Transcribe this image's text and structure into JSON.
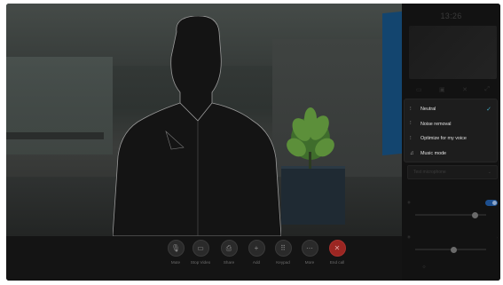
{
  "clock": "13:26",
  "controls": [
    {
      "id": "mute",
      "label": "Mute",
      "icon": "microphone-icon"
    },
    {
      "id": "stop-video",
      "label": "Stop Video",
      "icon": "camera-icon"
    },
    {
      "id": "share",
      "label": "Share",
      "icon": "share-icon"
    },
    {
      "id": "add",
      "label": "Add",
      "icon": "plus-icon"
    },
    {
      "id": "keypad",
      "label": "Keypad",
      "icon": "keypad-icon"
    },
    {
      "id": "more",
      "label": "More",
      "icon": "more-icon"
    },
    {
      "id": "end-call",
      "label": "End call",
      "icon": "close-icon"
    }
  ],
  "audio_menu": {
    "items": [
      {
        "label": "Neutral",
        "icon": "waveform-icon",
        "selected": true
      },
      {
        "label": "Noise removal",
        "icon": "noise-removal-icon",
        "selected": false
      },
      {
        "label": "Optimize for my voice",
        "icon": "voice-optimize-icon",
        "selected": false
      },
      {
        "label": "Music mode",
        "icon": "music-note-icon",
        "selected": false
      }
    ]
  },
  "test_microphone": "Test microphone",
  "colors": {
    "end_call": "#9b2622",
    "check": "#40a9c4",
    "toggle_on": "#1d4f8f"
  }
}
